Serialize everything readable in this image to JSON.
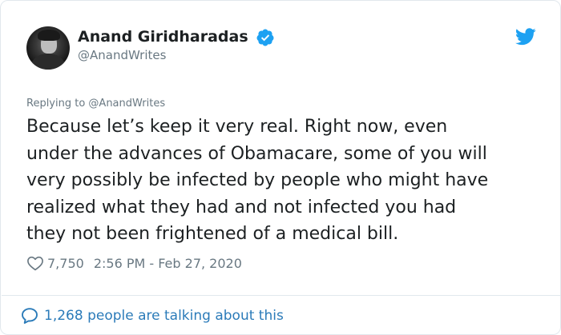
{
  "author": {
    "name": "Anand Giridharadas",
    "handle": "@AnandWrites",
    "verified": true
  },
  "reply_context": "Replying to @AnandWrites",
  "tweet_lines": [
    "Because let’s keep it very real. Right now, even",
    "under the advances of Obamacare, some of you will",
    "very possibly be infected by people who might have",
    "realized what they had and not infected you had",
    "they not been frightened of a medical bill."
  ],
  "likes": "7,750",
  "timestamp": "2:56 PM - Feb 27, 2020",
  "talking": "1,268 people are talking about this",
  "icons": {
    "verified": "verified-badge-icon",
    "bird": "twitter-bird-icon",
    "heart": "heart-outline-icon",
    "bubble": "speech-bubble-icon"
  },
  "colors": {
    "brand_blue": "#1da1f2",
    "link_blue": "#2b7bb9",
    "text": "#1c2022",
    "muted": "#697882",
    "border": "#e1e8ed"
  }
}
